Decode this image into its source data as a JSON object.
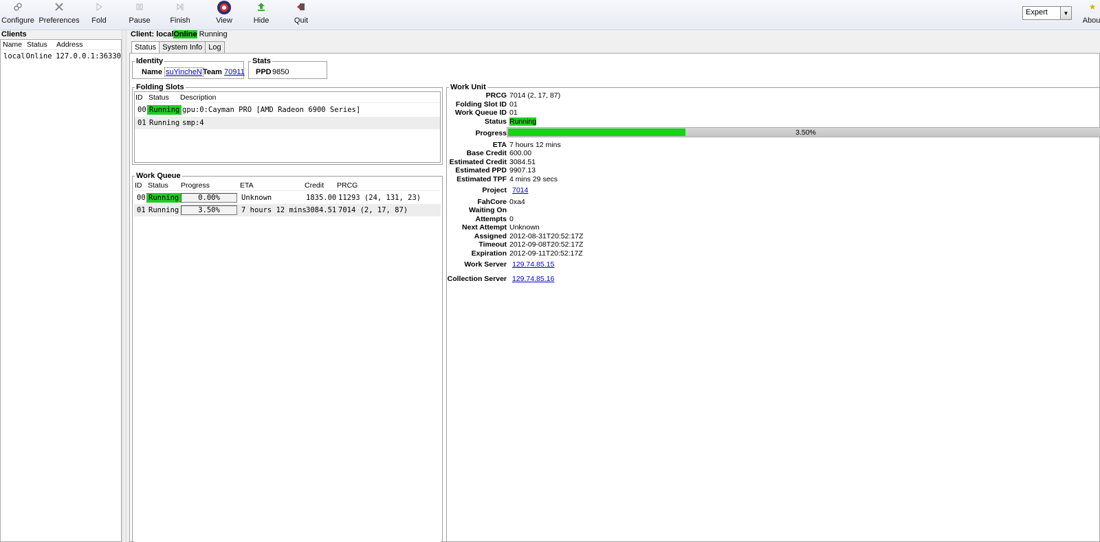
{
  "toolbar": {
    "buttons": [
      {
        "label": "Configure",
        "icon": "configure-icon"
      },
      {
        "label": "Preferences",
        "icon": "preferences-icon"
      },
      {
        "label": "Fold",
        "icon": "fold-icon"
      },
      {
        "label": "Pause",
        "icon": "pause-icon"
      },
      {
        "label": "Finish",
        "icon": "finish-icon"
      },
      {
        "label": "View",
        "icon": "view-icon"
      },
      {
        "label": "Hide",
        "icon": "hide-icon"
      },
      {
        "label": "Quit",
        "icon": "quit-icon"
      },
      {
        "label": "About",
        "icon": "about-icon"
      }
    ],
    "mode_value": "Expert"
  },
  "clients": {
    "title": "Clients",
    "columns": [
      "Name",
      "Status",
      "Address"
    ],
    "rows": [
      {
        "name": "local",
        "status": "Online",
        "address": "127.0.0.1:36330"
      }
    ]
  },
  "client_header": {
    "prefix": "Client:",
    "name": "local",
    "online": "Online",
    "state": "Running"
  },
  "tabs": [
    "Status",
    "System Info",
    "Log"
  ],
  "identity": {
    "title": "Identity",
    "name_label": "Name",
    "name_value": "suYincheN",
    "team_label": "Team",
    "team_value": "70911"
  },
  "stats": {
    "title": "Stats",
    "ppd_label": "PPD",
    "ppd_value": "9850"
  },
  "folding_slots": {
    "title": "Folding Slots",
    "columns": [
      "ID",
      "Status",
      "Description"
    ],
    "rows": [
      {
        "id": "00",
        "status": "Running",
        "description": "gpu:0:Cayman PRO [AMD Radeon 6900 Series]"
      },
      {
        "id": "01",
        "status": "Running",
        "description": "smp:4"
      }
    ]
  },
  "work_queue": {
    "title": "Work Queue",
    "columns": [
      "ID",
      "Status",
      "Progress",
      "ETA",
      "Credit",
      "PRCG"
    ],
    "rows": [
      {
        "id": "00",
        "status": "Running",
        "progress": "0.00%",
        "eta": "Unknown",
        "credit": "1835.00",
        "prcg": "11293 (24, 131, 23)"
      },
      {
        "id": "01",
        "status": "Running",
        "progress": "3.50%",
        "eta": "7 hours 12 mins",
        "credit": "3084.51",
        "prcg": "7014 (2, 17, 87)"
      }
    ]
  },
  "work_unit": {
    "title": "Work Unit",
    "prcg_label": "PRCG",
    "prcg": "7014 (2, 17, 87)",
    "slot_label": "Folding Slot ID",
    "slot": "01",
    "queue_label": "Work Queue ID",
    "queue": "01",
    "status_label": "Status",
    "status": "Running",
    "progress_label": "Progress",
    "progress_text": "3.50%",
    "progress_fraction": 0.035,
    "eta_label": "ETA",
    "eta": "7 hours 12 mins",
    "base_credit_label": "Base Credit",
    "base_credit": "600.00",
    "est_credit_label": "Estimated Credit",
    "est_credit": "3084.51",
    "est_ppd_label": "Estimated PPD",
    "est_ppd": "9907.13",
    "est_tpf_label": "Estimated TPF",
    "est_tpf": "4 mins 29 secs",
    "project_label": "Project",
    "project": "7014",
    "fahcore_label": "FahCore",
    "fahcore": "0xa4",
    "waiting_label": "Waiting On",
    "waiting": "",
    "attempts_label": "Attempts",
    "attempts": "0",
    "next_attempt_label": "Next Attempt",
    "next_attempt": "Unknown",
    "assigned_label": "Assigned",
    "assigned": "2012-08-31T20:52:17Z",
    "timeout_label": "Timeout",
    "timeout": "2012-09-08T20:52:17Z",
    "expiration_label": "Expiration",
    "expiration": "2012-09-11T20:52:17Z",
    "work_server_label": "Work Server",
    "work_server": "129.74.85.15",
    "collection_server_label": "Collection Server",
    "collection_server": "129.74.85.16"
  },
  "colors": {
    "running_green": "#22cc22",
    "link_blue": "#0000cc"
  }
}
